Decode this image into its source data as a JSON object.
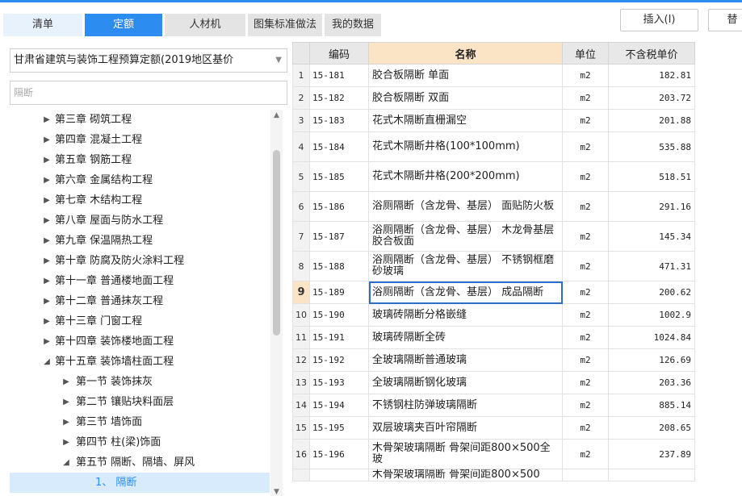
{
  "tabs": [
    {
      "label": "清单"
    },
    {
      "label": "定额"
    },
    {
      "label": "人材机"
    },
    {
      "label": "图集标准做法"
    },
    {
      "label": "我的数据"
    }
  ],
  "toolbar": {
    "insert_label": "插入(I)",
    "replace_label": "替"
  },
  "library": {
    "selected": "甘肃省建筑与装饰工程预算定额(2019地区基价"
  },
  "search": {
    "value": "隔断"
  },
  "tree": [
    {
      "label": "第三章 砌筑工程",
      "level": 0,
      "state": "collapsed"
    },
    {
      "label": "第四章 混凝土工程",
      "level": 0,
      "state": "collapsed"
    },
    {
      "label": "第五章 钢筋工程",
      "level": 0,
      "state": "collapsed"
    },
    {
      "label": "第六章 金属结构工程",
      "level": 0,
      "state": "collapsed"
    },
    {
      "label": "第七章 木结构工程",
      "level": 0,
      "state": "collapsed"
    },
    {
      "label": "第八章 屋面与防水工程",
      "level": 0,
      "state": "collapsed"
    },
    {
      "label": "第九章 保温隔热工程",
      "level": 0,
      "state": "collapsed"
    },
    {
      "label": "第十章 防腐及防火涂料工程",
      "level": 0,
      "state": "collapsed"
    },
    {
      "label": "第十一章 普通楼地面工程",
      "level": 0,
      "state": "collapsed"
    },
    {
      "label": "第十二章 普通抹灰工程",
      "level": 0,
      "state": "collapsed"
    },
    {
      "label": "第十三章 门窗工程",
      "level": 0,
      "state": "collapsed"
    },
    {
      "label": "第十四章 装饰楼地面工程",
      "level": 0,
      "state": "collapsed"
    },
    {
      "label": "第十五章 装饰墙柱面工程",
      "level": 0,
      "state": "expanded"
    },
    {
      "label": "第一节 装饰抹灰",
      "level": 1,
      "state": "collapsed"
    },
    {
      "label": "第二节 镶贴块料面层",
      "level": 1,
      "state": "collapsed"
    },
    {
      "label": "第三节 墙饰面",
      "level": 1,
      "state": "collapsed"
    },
    {
      "label": "第四节 柱(梁)饰面",
      "level": 1,
      "state": "collapsed"
    },
    {
      "label": "第五节 隔断、隔墙、屏风",
      "level": 1,
      "state": "expanded"
    },
    {
      "label": "1、 隔断",
      "level": 2,
      "state": "leaf",
      "selected": true
    }
  ],
  "grid": {
    "columns": [
      "编码",
      "名称",
      "单位",
      "不含税单价"
    ],
    "current_row": 9,
    "rows": [
      {
        "idx": "1",
        "code": "15-181",
        "name": "胶合板隔断 单面",
        "unit": "m2",
        "price": "182.81"
      },
      {
        "idx": "2",
        "code": "15-182",
        "name": "胶合板隔断 双面",
        "unit": "m2",
        "price": "203.72"
      },
      {
        "idx": "3",
        "code": "15-183",
        "name": "花式木隔断直栅漏空",
        "unit": "m2",
        "price": "201.88"
      },
      {
        "idx": "4",
        "code": "15-184",
        "name": "花式木隔断井格(100*100mm)",
        "unit": "m2",
        "price": "535.88"
      },
      {
        "idx": "5",
        "code": "15-185",
        "name": "花式木隔断井格(200*200mm)",
        "unit": "m2",
        "price": "518.51"
      },
      {
        "idx": "6",
        "code": "15-186",
        "name": "浴厕隔断（含龙骨、基层） 面贴防火板",
        "unit": "m2",
        "price": "291.16"
      },
      {
        "idx": "7",
        "code": "15-187",
        "name": "浴厕隔断（含龙骨、基层） 木龙骨基层胶合板面",
        "unit": "m2",
        "price": "145.34"
      },
      {
        "idx": "8",
        "code": "15-188",
        "name": "浴厕隔断（含龙骨、基层） 不锈钢框磨砂玻璃",
        "unit": "m2",
        "price": "471.31"
      },
      {
        "idx": "9",
        "code": "15-189",
        "name": "浴厕隔断（含龙骨、基层） 成品隔断",
        "unit": "m2",
        "price": "200.62"
      },
      {
        "idx": "10",
        "code": "15-190",
        "name": "玻璃砖隔断分格嵌缝",
        "unit": "m2",
        "price": "1002.9"
      },
      {
        "idx": "11",
        "code": "15-191",
        "name": "玻璃砖隔断全砖",
        "unit": "m2",
        "price": "1024.84"
      },
      {
        "idx": "12",
        "code": "15-192",
        "name": "全玻璃隔断普通玻璃",
        "unit": "m2",
        "price": "126.69"
      },
      {
        "idx": "13",
        "code": "15-193",
        "name": "全玻璃隔断钢化玻璃",
        "unit": "m2",
        "price": "203.36"
      },
      {
        "idx": "14",
        "code": "15-194",
        "name": "不锈钢柱防弹玻璃隔断",
        "unit": "m2",
        "price": "885.14"
      },
      {
        "idx": "15",
        "code": "15-195",
        "name": "双层玻璃夹百叶帘隔断",
        "unit": "m2",
        "price": "208.65"
      },
      {
        "idx": "16",
        "code": "15-196",
        "name": "木骨架玻璃隔断 骨架间距800×500全玻",
        "unit": "m2",
        "price": "237.89"
      },
      {
        "idx": "",
        "code": "",
        "name": "木骨架玻璃隔断 骨架间距800×500",
        "unit": "",
        "price": ""
      }
    ]
  }
}
